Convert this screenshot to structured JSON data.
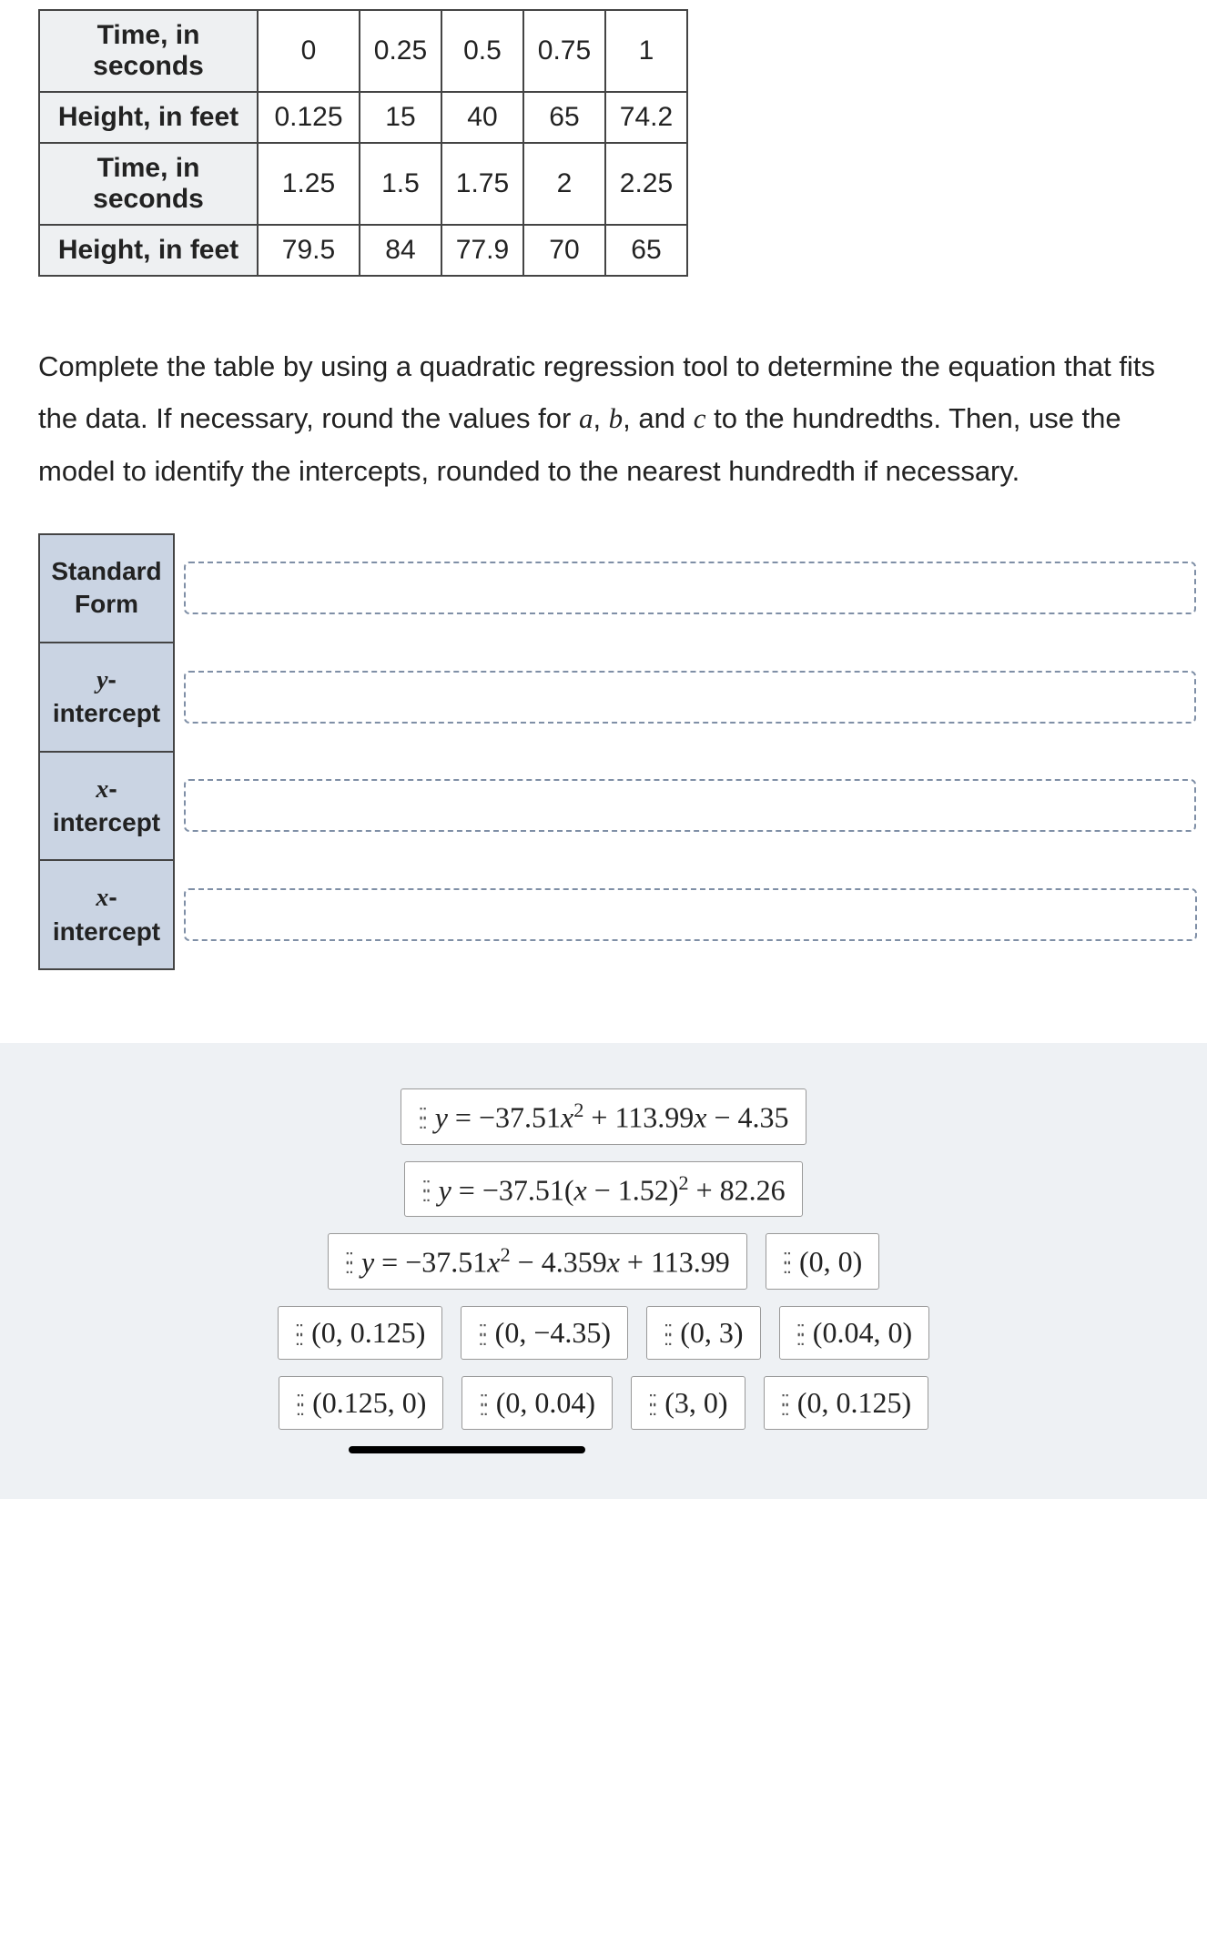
{
  "data_table": {
    "rows": [
      {
        "label": "Time, in seconds",
        "values": [
          "0",
          "0.25",
          "0.5",
          "0.75",
          "1"
        ]
      },
      {
        "label": "Height, in feet",
        "values": [
          "0.125",
          "15",
          "40",
          "65",
          "74.2"
        ]
      },
      {
        "label": "Time, in seconds",
        "values": [
          "1.25",
          "1.5",
          "1.75",
          "2",
          "2.25"
        ]
      },
      {
        "label": "Height, in feet",
        "values": [
          "79.5",
          "84",
          "77.9",
          "70",
          "65"
        ]
      }
    ]
  },
  "instructions": {
    "part1": "Complete the table by using a quadratic regression tool to determine the equation that fits the data. If necessary, round the values for ",
    "a": "a",
    "comma1": ", ",
    "b": "b",
    "comma2": ", and ",
    "c": "c",
    "part2": " to the hundredths. Then, use the model to identify the intercepts, rounded to the nearest hundredth if necessary."
  },
  "answer_form": {
    "rows": [
      {
        "label_html": "Standard<br>Form"
      },
      {
        "label_html": "<span class='mi'>y</span>-<br>intercept"
      },
      {
        "label_html": "<span class='mi'>x</span>-<br>intercept"
      },
      {
        "label_html": "<span class='mi'>x</span>-<br>intercept"
      }
    ]
  },
  "tiles": [
    [
      {
        "html": "<span class='mi'>y</span> <span class='eq'>=</span> −37.51<span class='mi'>x</span><sup>2</sup> + 113.99<span class='mi'>x</span> − 4.35"
      }
    ],
    [
      {
        "html": "<span class='mi'>y</span> <span class='eq'>=</span> −37.51(<span class='mi'>x</span> − 1.52)<sup>2</sup> + 82.26"
      }
    ],
    [
      {
        "html": "<span class='mi'>y</span> <span class='eq'>=</span> −37.51<span class='mi'>x</span><sup>2</sup> − 4.359<span class='mi'>x</span> + 113.99"
      },
      {
        "html": "(0, 0)"
      }
    ],
    [
      {
        "html": "(0, 0.125)"
      },
      {
        "html": "(0, −4.35)"
      },
      {
        "html": "(0, 3)"
      },
      {
        "html": "(0.04, 0)"
      }
    ],
    [
      {
        "html": "(0.125, 0)"
      },
      {
        "html": "(0, 0.04)"
      },
      {
        "html": "(3, 0)"
      },
      {
        "html": "(0, 0.125)"
      }
    ]
  ]
}
